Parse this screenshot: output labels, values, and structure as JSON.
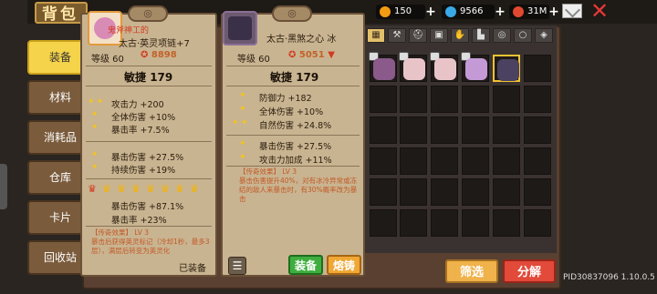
{
  "header": {
    "title": "背包",
    "currencies": [
      {
        "name": "coin-icon",
        "value": "150",
        "color": "#f39c12"
      },
      {
        "name": "gem-icon",
        "value": "9566",
        "color": "#3aa8e6"
      },
      {
        "name": "token-icon",
        "value": "31M",
        "color": "#e0492f"
      }
    ]
  },
  "tabs": [
    {
      "label": "装备",
      "active": true
    },
    {
      "label": "材料",
      "active": false
    },
    {
      "label": "消耗品",
      "active": false
    },
    {
      "label": "仓库",
      "active": false
    },
    {
      "label": "卡片",
      "active": false
    },
    {
      "label": "回收站",
      "active": false
    }
  ],
  "card_left": {
    "tag": "鬼斧神工的",
    "name": "太古·英灵项链+7",
    "level": "等级 60",
    "power": "8898",
    "main_stat": "敏捷",
    "main_value": "179",
    "stats": [
      "攻击力 +200",
      "全体伤害 +10%",
      "暴击率 +7.5%"
    ],
    "stats2": [
      "暴击伤害 +27.5%",
      "持续伤害 +19%"
    ],
    "crown_stats": [
      "暴击伤害 +87.1%",
      "暴击率 +23%"
    ],
    "legend_title": "【传奇效果】 LV 3",
    "legend_text": "暴击后获得英灵标记（冷却1秒，最多3层），满层后转变为英灵化",
    "status": "已装备"
  },
  "card_right": {
    "name": "太古·黑煞之心 冰",
    "level": "等级 60",
    "power": "5051",
    "main_stat": "敏捷",
    "main_value": "179",
    "stats": [
      "防御力 +182",
      "全体伤害 +10%",
      "自然伤害 +24.8%"
    ],
    "stats2": [
      "暴击伤害 +27.5%",
      "攻击力加成 +11%"
    ],
    "legend_title": "【传奇效果】 LV 3",
    "legend_text": "暴击伤害提升40%，对有冰冷异常或冻结的敌人来暴击时，有30%概率改为暴击",
    "equip_label": "装备",
    "smelt_label": "熔铸"
  },
  "footer": {
    "filter_label": "筛选",
    "decompose_label": "分解",
    "pid": "PID30837096 1.10.0.5"
  }
}
